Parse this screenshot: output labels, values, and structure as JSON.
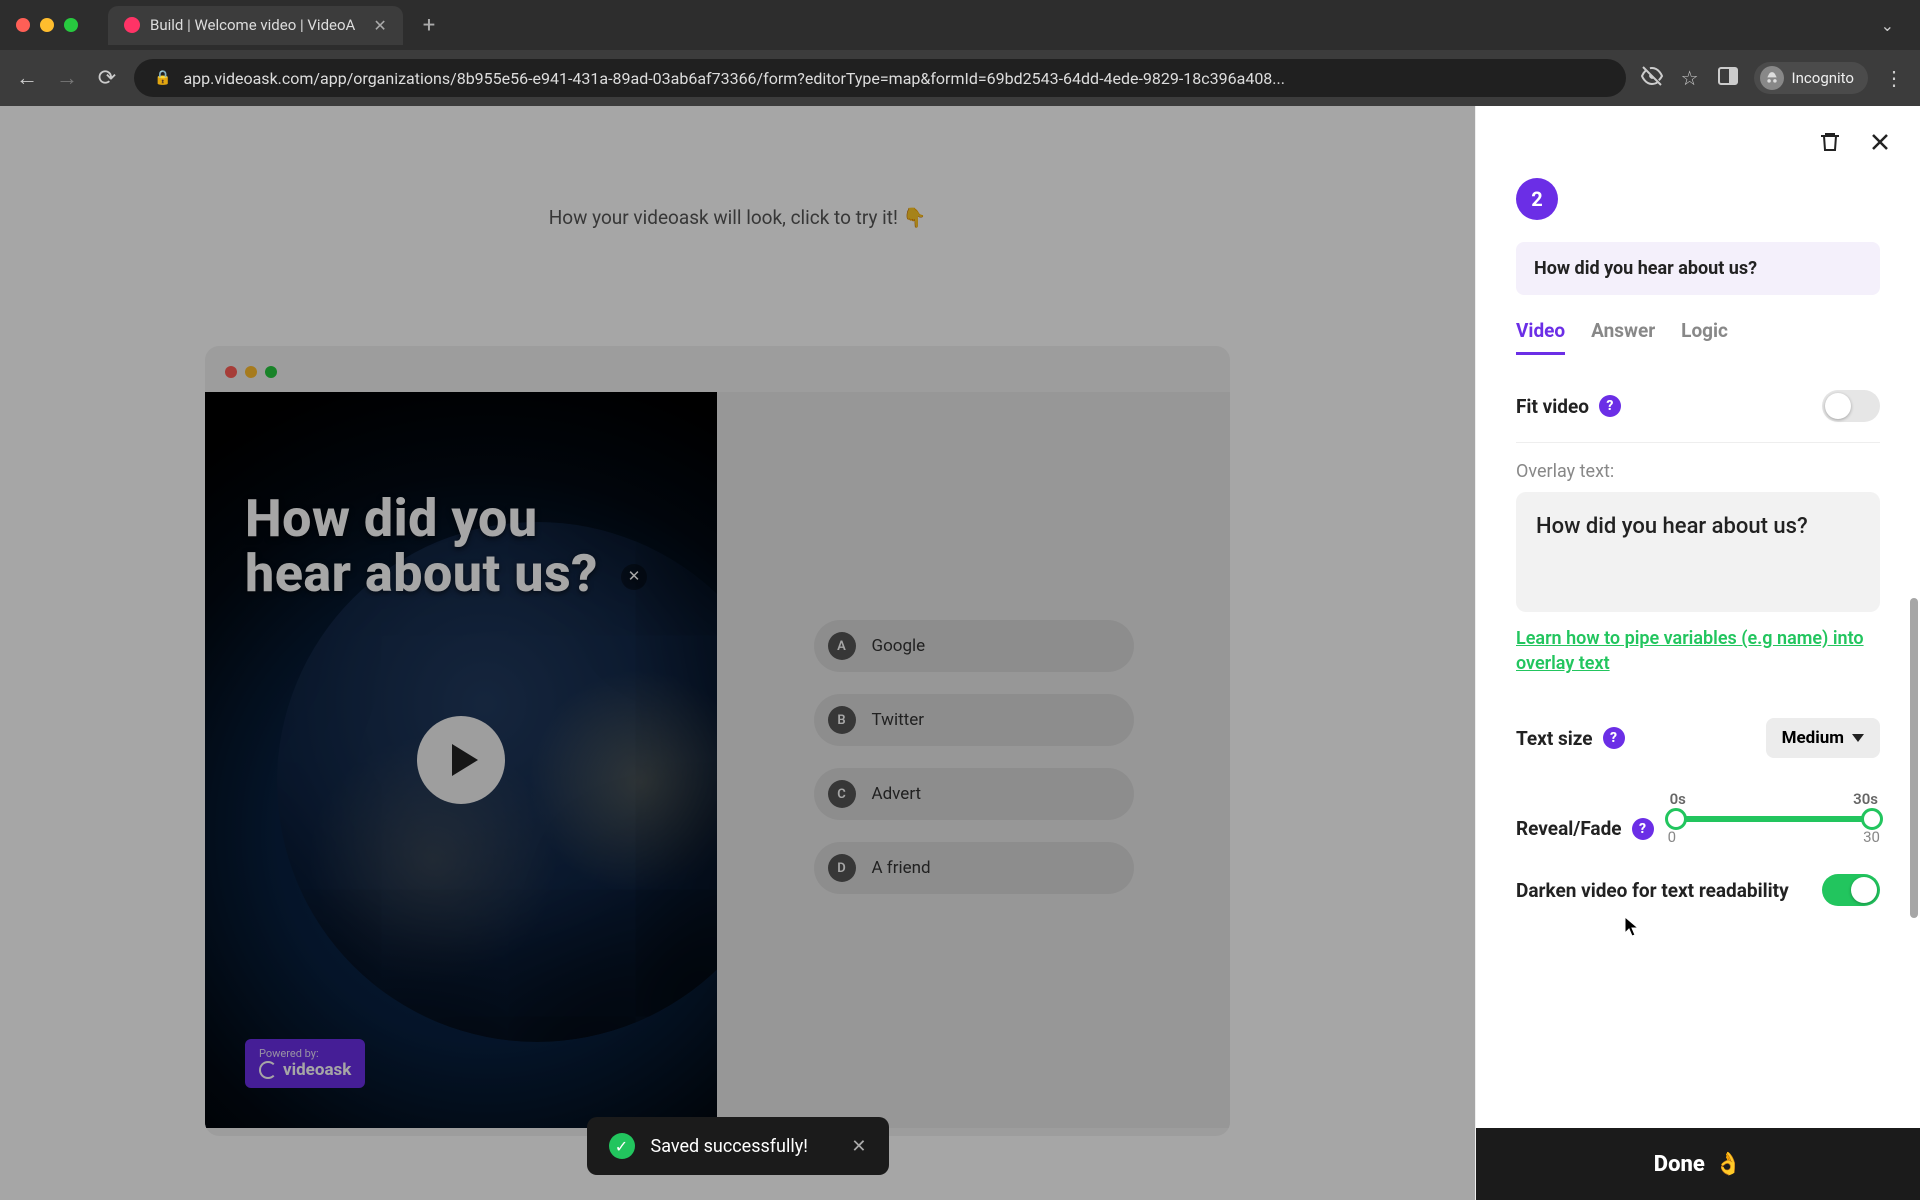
{
  "browser": {
    "tab_title": "Build | Welcome video | VideoA",
    "url": "app.videoask.com/app/organizations/8b955e56-e941-431a-89ad-03ab6af73366/form?editorType=map&formId=69bd2543-64dd-4ede-9829-18c396a408...",
    "profile": "Incognito"
  },
  "hint": "How your videoask will look, click to try it!",
  "preview": {
    "overlay_text": "How did you hear about us?",
    "brand_prefix": "Powered by:",
    "brand_name": "videoask",
    "choices": [
      {
        "key": "A",
        "label": "Google"
      },
      {
        "key": "B",
        "label": "Twitter"
      },
      {
        "key": "C",
        "label": "Advert"
      },
      {
        "key": "D",
        "label": "A friend"
      }
    ]
  },
  "toast": {
    "text": "Saved successfully!"
  },
  "panel": {
    "step_number": "2",
    "question": "How did you hear about us?",
    "tabs": {
      "video": "Video",
      "answer": "Answer",
      "logic": "Logic"
    },
    "fit_video_label": "Fit video",
    "overlay_text_label": "Overlay text:",
    "overlay_text_value": "How did you hear about us?",
    "learn_link": "Learn how to pipe variables (e.g name) into overlay text",
    "text_size_label": "Text size",
    "text_size_value": "Medium",
    "reveal_fade_label": "Reveal/Fade",
    "reveal_fade_start_label": "0s",
    "reveal_fade_end_label": "30s",
    "reveal_fade_min": "0",
    "reveal_fade_max": "30",
    "darken_label": "Darken video for text readability",
    "done_label": "Done"
  }
}
